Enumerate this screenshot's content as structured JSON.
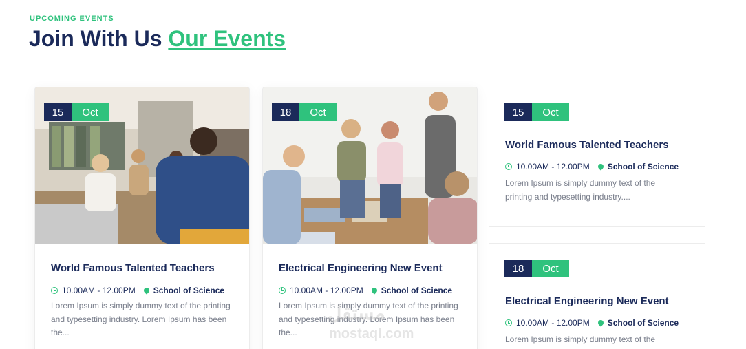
{
  "header": {
    "eyebrow": "UPCOMING EVENTS",
    "title_main": "Join With Us",
    "title_accent": "Our Events"
  },
  "colors": {
    "navy": "#1b2a5a",
    "green": "#2fc27d",
    "muted_text": "#7a7f8c"
  },
  "events": [
    {
      "day": "15",
      "month": "Oct",
      "title": "World Famous Talented Teachers",
      "time": "10.00AM - 12.00PM",
      "location": "School of Science",
      "description": "Lorem Ipsum is simply dummy text of the printing and typesetting industry. Lorem Ipsum has been the...",
      "image_icon": "classroom-photo"
    },
    {
      "day": "18",
      "month": "Oct",
      "title": "Electrical Engineering New Event",
      "time": "10.00AM - 12.00PM",
      "location": "School of Science",
      "description": "Lorem Ipsum is simply dummy text of the printing and typesetting industry. Lorem Ipsum has been the...",
      "image_icon": "students-photo"
    },
    {
      "day": "15",
      "month": "Oct",
      "title": "World Famous Talented Teachers",
      "time": "10.00AM - 12.00PM",
      "location": "School of Science",
      "description": "Lorem Ipsum is simply dummy text of the printing and typesetting industry...."
    },
    {
      "day": "18",
      "month": "Oct",
      "title": "Electrical Engineering New Event",
      "time": "10.00AM - 12.00PM",
      "location": "School of Science",
      "description": "Lorem Ipsum is simply dummy text of the"
    }
  ],
  "watermark": {
    "text": "مستقل",
    "sub": "mostaql.com"
  }
}
